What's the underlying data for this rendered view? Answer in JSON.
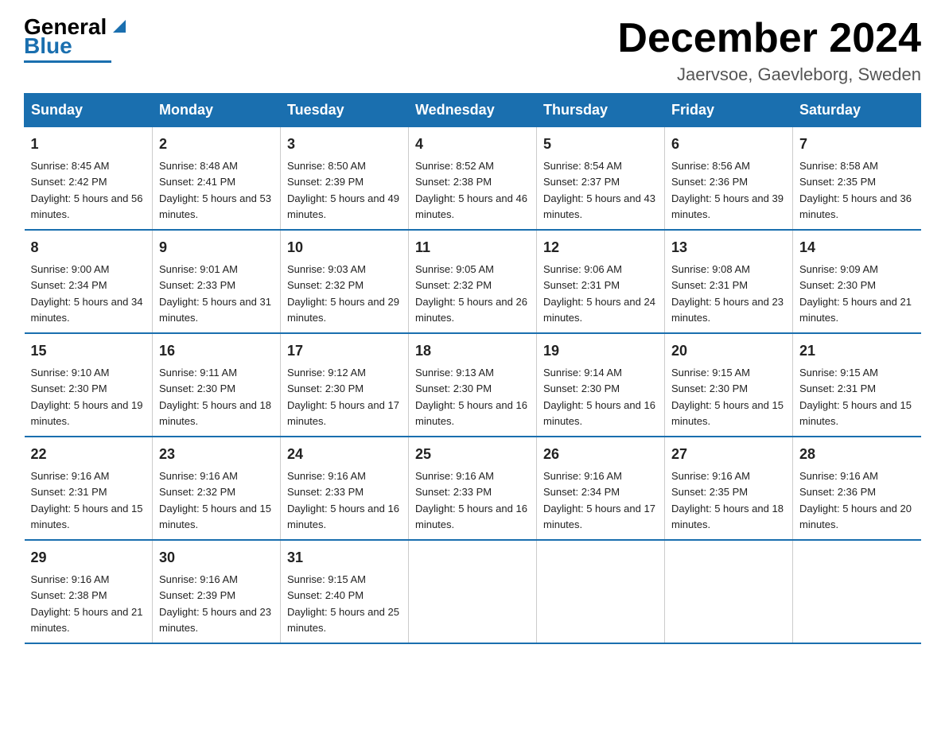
{
  "logo": {
    "general": "General",
    "blue": "Blue"
  },
  "title": "December 2024",
  "location": "Jaervsoe, Gaevleborg, Sweden",
  "days_of_week": [
    "Sunday",
    "Monday",
    "Tuesday",
    "Wednesday",
    "Thursday",
    "Friday",
    "Saturday"
  ],
  "weeks": [
    [
      {
        "day": "1",
        "sunrise": "8:45 AM",
        "sunset": "2:42 PM",
        "daylight": "5 hours and 56 minutes."
      },
      {
        "day": "2",
        "sunrise": "8:48 AM",
        "sunset": "2:41 PM",
        "daylight": "5 hours and 53 minutes."
      },
      {
        "day": "3",
        "sunrise": "8:50 AM",
        "sunset": "2:39 PM",
        "daylight": "5 hours and 49 minutes."
      },
      {
        "day": "4",
        "sunrise": "8:52 AM",
        "sunset": "2:38 PM",
        "daylight": "5 hours and 46 minutes."
      },
      {
        "day": "5",
        "sunrise": "8:54 AM",
        "sunset": "2:37 PM",
        "daylight": "5 hours and 43 minutes."
      },
      {
        "day": "6",
        "sunrise": "8:56 AM",
        "sunset": "2:36 PM",
        "daylight": "5 hours and 39 minutes."
      },
      {
        "day": "7",
        "sunrise": "8:58 AM",
        "sunset": "2:35 PM",
        "daylight": "5 hours and 36 minutes."
      }
    ],
    [
      {
        "day": "8",
        "sunrise": "9:00 AM",
        "sunset": "2:34 PM",
        "daylight": "5 hours and 34 minutes."
      },
      {
        "day": "9",
        "sunrise": "9:01 AM",
        "sunset": "2:33 PM",
        "daylight": "5 hours and 31 minutes."
      },
      {
        "day": "10",
        "sunrise": "9:03 AM",
        "sunset": "2:32 PM",
        "daylight": "5 hours and 29 minutes."
      },
      {
        "day": "11",
        "sunrise": "9:05 AM",
        "sunset": "2:32 PM",
        "daylight": "5 hours and 26 minutes."
      },
      {
        "day": "12",
        "sunrise": "9:06 AM",
        "sunset": "2:31 PM",
        "daylight": "5 hours and 24 minutes."
      },
      {
        "day": "13",
        "sunrise": "9:08 AM",
        "sunset": "2:31 PM",
        "daylight": "5 hours and 23 minutes."
      },
      {
        "day": "14",
        "sunrise": "9:09 AM",
        "sunset": "2:30 PM",
        "daylight": "5 hours and 21 minutes."
      }
    ],
    [
      {
        "day": "15",
        "sunrise": "9:10 AM",
        "sunset": "2:30 PM",
        "daylight": "5 hours and 19 minutes."
      },
      {
        "day": "16",
        "sunrise": "9:11 AM",
        "sunset": "2:30 PM",
        "daylight": "5 hours and 18 minutes."
      },
      {
        "day": "17",
        "sunrise": "9:12 AM",
        "sunset": "2:30 PM",
        "daylight": "5 hours and 17 minutes."
      },
      {
        "day": "18",
        "sunrise": "9:13 AM",
        "sunset": "2:30 PM",
        "daylight": "5 hours and 16 minutes."
      },
      {
        "day": "19",
        "sunrise": "9:14 AM",
        "sunset": "2:30 PM",
        "daylight": "5 hours and 16 minutes."
      },
      {
        "day": "20",
        "sunrise": "9:15 AM",
        "sunset": "2:30 PM",
        "daylight": "5 hours and 15 minutes."
      },
      {
        "day": "21",
        "sunrise": "9:15 AM",
        "sunset": "2:31 PM",
        "daylight": "5 hours and 15 minutes."
      }
    ],
    [
      {
        "day": "22",
        "sunrise": "9:16 AM",
        "sunset": "2:31 PM",
        "daylight": "5 hours and 15 minutes."
      },
      {
        "day": "23",
        "sunrise": "9:16 AM",
        "sunset": "2:32 PM",
        "daylight": "5 hours and 15 minutes."
      },
      {
        "day": "24",
        "sunrise": "9:16 AM",
        "sunset": "2:33 PM",
        "daylight": "5 hours and 16 minutes."
      },
      {
        "day": "25",
        "sunrise": "9:16 AM",
        "sunset": "2:33 PM",
        "daylight": "5 hours and 16 minutes."
      },
      {
        "day": "26",
        "sunrise": "9:16 AM",
        "sunset": "2:34 PM",
        "daylight": "5 hours and 17 minutes."
      },
      {
        "day": "27",
        "sunrise": "9:16 AM",
        "sunset": "2:35 PM",
        "daylight": "5 hours and 18 minutes."
      },
      {
        "day": "28",
        "sunrise": "9:16 AM",
        "sunset": "2:36 PM",
        "daylight": "5 hours and 20 minutes."
      }
    ],
    [
      {
        "day": "29",
        "sunrise": "9:16 AM",
        "sunset": "2:38 PM",
        "daylight": "5 hours and 21 minutes."
      },
      {
        "day": "30",
        "sunrise": "9:16 AM",
        "sunset": "2:39 PM",
        "daylight": "5 hours and 23 minutes."
      },
      {
        "day": "31",
        "sunrise": "9:15 AM",
        "sunset": "2:40 PM",
        "daylight": "5 hours and 25 minutes."
      },
      null,
      null,
      null,
      null
    ]
  ]
}
